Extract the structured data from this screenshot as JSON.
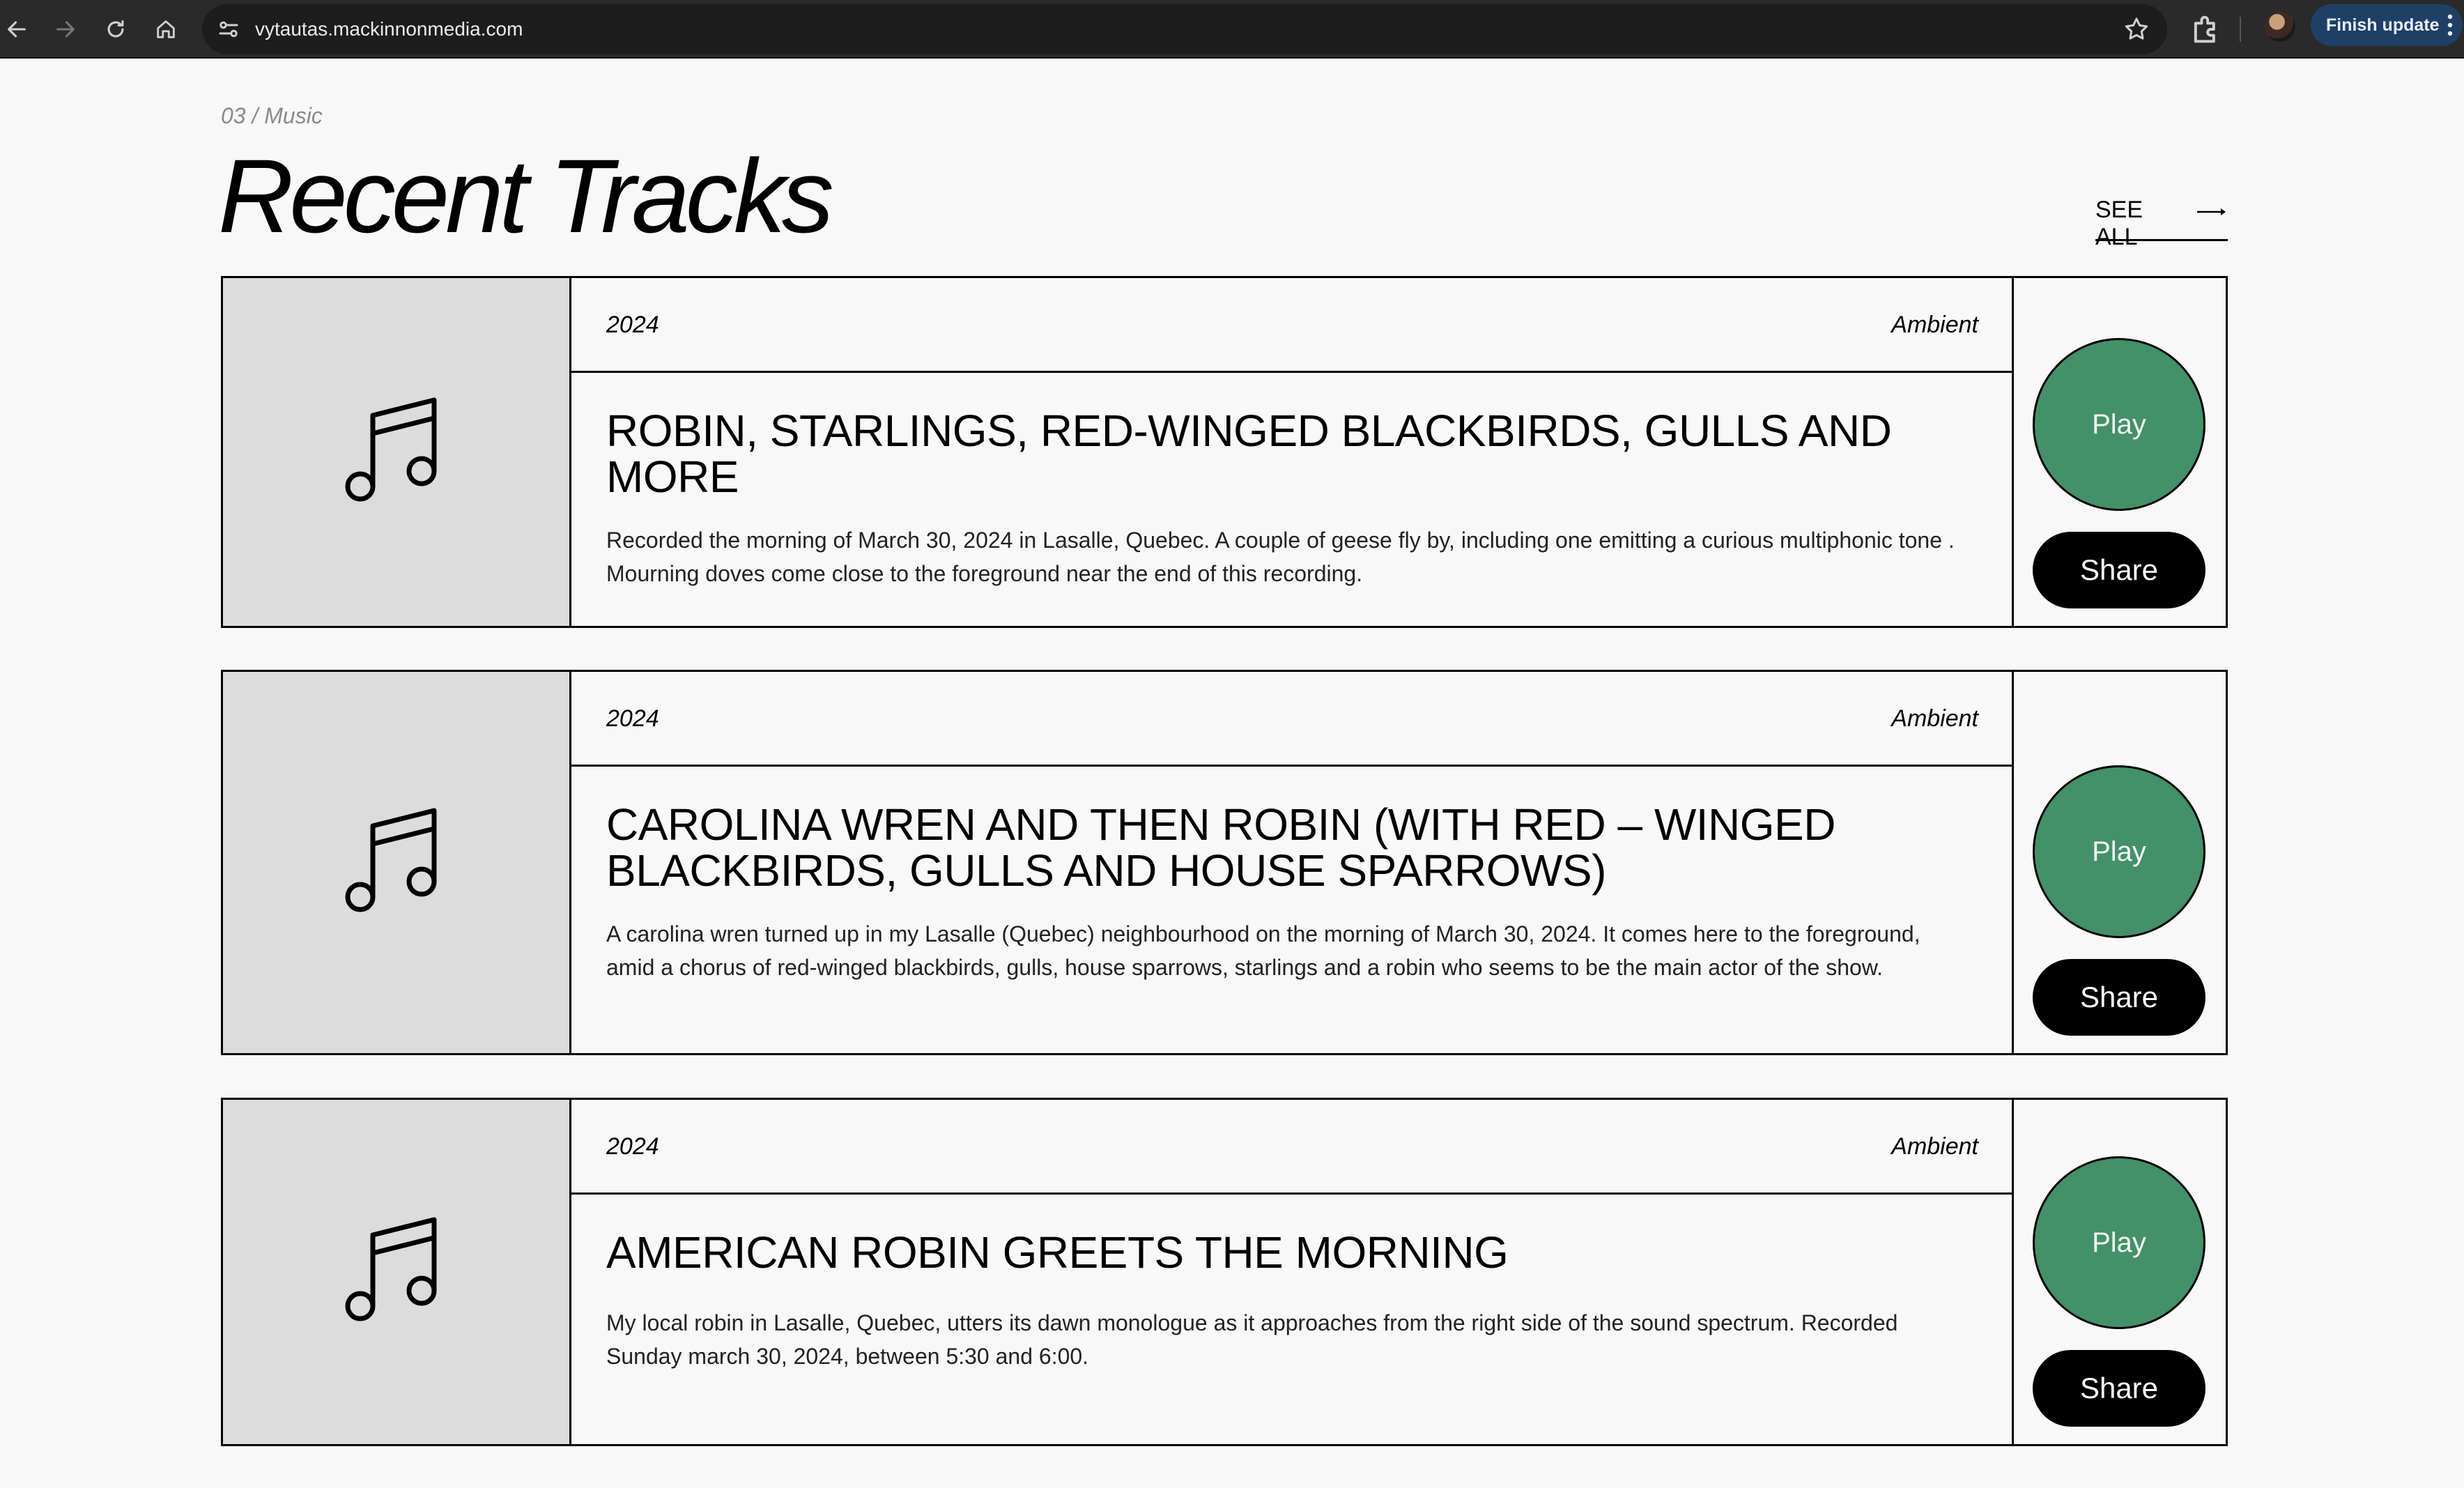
{
  "browser": {
    "url": "vytautas.mackinnonmedia.com",
    "finish_update_label": "Finish update"
  },
  "header": {
    "eyebrow": "03 / Music",
    "title": "Recent Tracks",
    "see_all_label": "SEE ALL"
  },
  "tracks": [
    {
      "year": "2024",
      "genre": "Ambient",
      "title": "ROBIN, STARLINGS, RED-WINGED BLACKBIRDS, GULLS AND MORE",
      "description": "Recorded the morning of March 30, 2024 in Lasalle, Quebec. A couple of geese fly by, including one emitting a curious multiphonic tone . Mourning doves come close to the foreground near the end of this recording.",
      "play_label": "Play",
      "share_label": "Share"
    },
    {
      "year": "2024",
      "genre": "Ambient",
      "title": "CAROLINA WREN AND THEN ROBIN (WITH RED – WINGED BLACKBIRDS, GULLS AND HOUSE SPARROWS)",
      "description": "A carolina wren turned up in my Lasalle (Quebec) neighbourhood on the morning of March 30, 2024. It comes here to the foreground, amid a chorus of red-winged blackbirds, gulls, house sparrows, starlings and a robin who seems to be the main actor of the show.",
      "play_label": "Play",
      "share_label": "Share"
    },
    {
      "year": "2024",
      "genre": "Ambient",
      "title": "AMERICAN ROBIN GREETS THE MORNING",
      "description": "My local robin in Lasalle, Quebec, utters its dawn monologue as it approaches from the right side of the sound spectrum. Recorded Sunday march 30, 2024, between 5:30 and 6:00.",
      "play_label": "Play",
      "share_label": "Share"
    }
  ],
  "icons": {
    "back": "back-arrow-icon",
    "forward": "forward-arrow-icon",
    "reload": "reload-icon",
    "home": "home-icon",
    "site_settings": "tune-icon",
    "bookmark": "star-icon",
    "extensions": "puzzle-icon",
    "track_thumb": "music-note-icon"
  },
  "colors": {
    "play": "#449069",
    "share": "#000000",
    "thumb_bg": "#dcdcdc",
    "page_bg": "#f8f8f8",
    "chrome_bg": "#2a2a2a"
  }
}
